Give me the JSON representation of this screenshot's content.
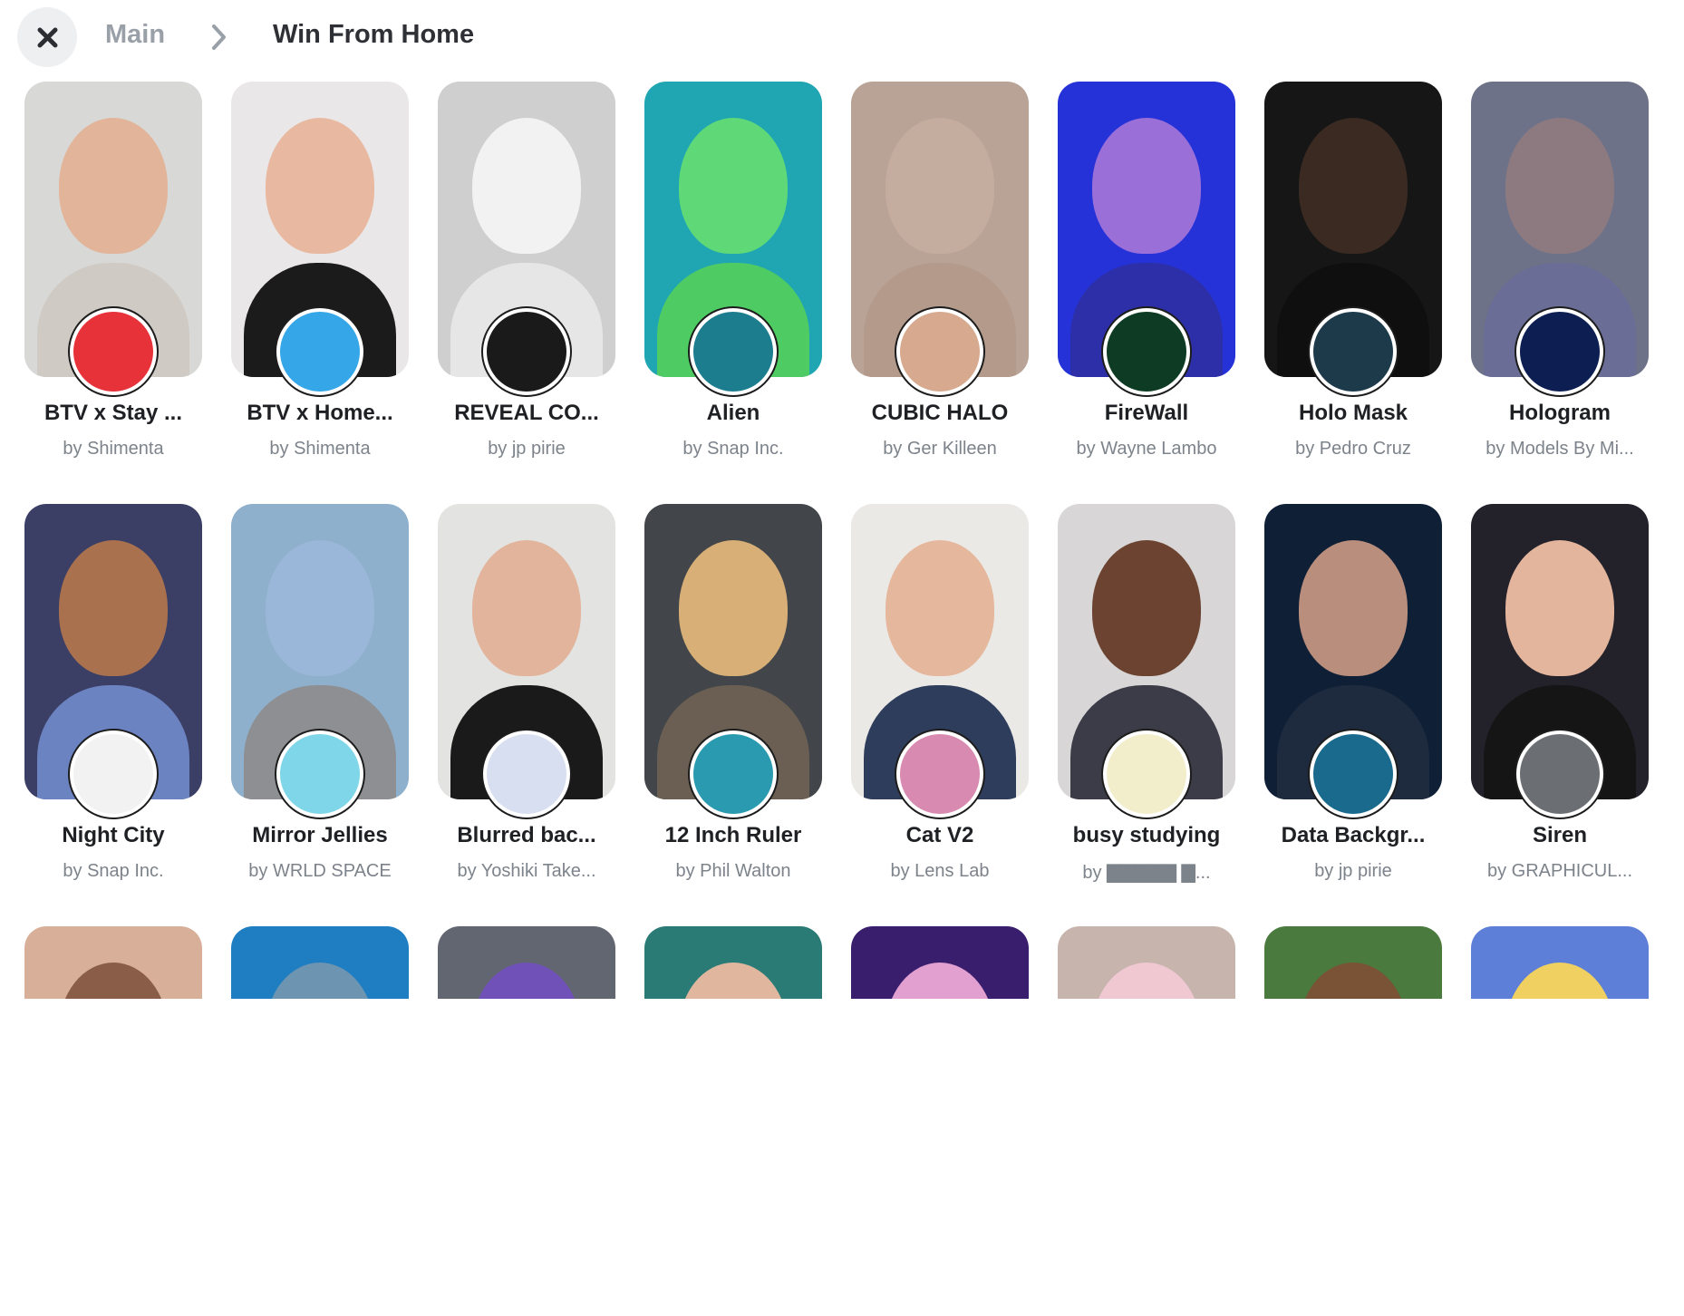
{
  "header": {
    "close_icon": "close-icon",
    "breadcrumb_main": "Main",
    "chevron_icon": "chevron-right-icon",
    "breadcrumb_current": "Win From Home"
  },
  "lenses": [
    {
      "title": "BTV x Stay ...",
      "author": "by Shimenta",
      "bg": "#d8d8d6",
      "face": "#e2b59a",
      "body": "#cfcac4",
      "badge": "#e8323a"
    },
    {
      "title": "BTV x Home...",
      "author": "by Shimenta",
      "bg": "#eae7e9",
      "face": "#e8b9a0",
      "body": "#1b1b1b",
      "badge": "#35a7e8"
    },
    {
      "title": "REVEAL CO...",
      "author": "by jp pirie",
      "bg": "#cfcfcf",
      "face": "#f2f2f2",
      "body": "#e6e6e6",
      "badge": "#1a1a1a"
    },
    {
      "title": "Alien",
      "author": "by Snap Inc.",
      "bg": "#1fa6b2",
      "face": "#5fd878",
      "body": "#4fcb63",
      "badge": "#1b7d8e"
    },
    {
      "title": "CUBIC HALO",
      "author": "by Ger Killeen",
      "bg": "#b8a396",
      "face": "#c4ad9f",
      "body": "#b39a8b",
      "badge": "#d7a98e"
    },
    {
      "title": "FireWall",
      "author": "by Wayne Lambo",
      "bg": "#2532d8",
      "face": "#9b6fd8",
      "body": "#2d2fa8",
      "badge": "#0e3b24"
    },
    {
      "title": "Holo Mask",
      "author": "by Pedro Cruz",
      "bg": "#161616",
      "face": "#3a2a22",
      "body": "#0f0f0f",
      "badge": "#1d3a4a"
    },
    {
      "title": "Hologram",
      "author": "by Models By Mi...",
      "bg": "#6d7288",
      "face": "#8d7a80",
      "body": "#6a6d96",
      "badge": "#0c1e52"
    },
    {
      "title": "Night City",
      "author": "by Snap Inc.",
      "bg": "#3b3f66",
      "face": "#a9714e",
      "body": "#6c83c2",
      "badge": "#f2f2f2"
    },
    {
      "title": "Mirror Jellies",
      "author": "by WRLD SPACE",
      "bg": "#8fb0cc",
      "face": "#9ab6d8",
      "body": "#8e8f93",
      "badge": "#7fd6e8"
    },
    {
      "title": "Blurred bac...",
      "author": "by Yoshiki Take...",
      "bg": "#e3e3e1",
      "face": "#e2b49b",
      "body": "#1a1a1a",
      "badge": "#d8dff0"
    },
    {
      "title": "12 Inch Ruler",
      "author": "by Phil Walton",
      "bg": "#424549",
      "face": "#d8b077",
      "body": "#6a5f52",
      "badge": "#2a9ab0"
    },
    {
      "title": "Cat V2",
      "author": "by Lens Lab",
      "bg": "#ebe9e6",
      "face": "#e5b79c",
      "body": "#2f3d5c",
      "badge": "#d88ab0"
    },
    {
      "title": "busy studying",
      "author": "by ▇▇▇▇▇ ▇...",
      "bg": "#d8d6d6",
      "face": "#6b4330",
      "body": "#3c3c48",
      "badge": "#f2eecc"
    },
    {
      "title": "Data Backgr...",
      "author": "by jp pirie",
      "bg": "#0f1f36",
      "face": "#b98e7c",
      "body": "#1e2b3e",
      "badge": "#1a6a8e"
    },
    {
      "title": "Siren",
      "author": "by GRAPHICUL...",
      "bg": "#23222b",
      "face": "#e4b59d",
      "body": "#151515",
      "badge": "#6b6f74"
    },
    {
      "title": "",
      "author": "",
      "bg": "#d8b09a",
      "face": "#8a5d48",
      "body": "#d8b09a",
      "badge": ""
    },
    {
      "title": "",
      "author": "",
      "bg": "#1f7ec2",
      "face": "#6d95b2",
      "body": "#1f7ec2",
      "badge": ""
    },
    {
      "title": "",
      "author": "",
      "bg": "#626670",
      "face": "#6f51b8",
      "body": "#626670",
      "badge": ""
    },
    {
      "title": "",
      "author": "",
      "bg": "#2a7a76",
      "face": "#e0b79e",
      "body": "#2a7a76",
      "badge": ""
    },
    {
      "title": "",
      "author": "",
      "bg": "#3a1e6e",
      "face": "#e2a0d0",
      "body": "#3a1e6e",
      "badge": ""
    },
    {
      "title": "",
      "author": "",
      "bg": "#c6b4ad",
      "face": "#f0c8d2",
      "body": "#c6b4ad",
      "badge": ""
    },
    {
      "title": "",
      "author": "",
      "bg": "#4b7a3e",
      "face": "#7a5235",
      "body": "#4b7a3e",
      "badge": ""
    },
    {
      "title": "",
      "author": "",
      "bg": "#5d7fd8",
      "face": "#f0d060",
      "body": "#5d7fd8",
      "badge": ""
    }
  ]
}
